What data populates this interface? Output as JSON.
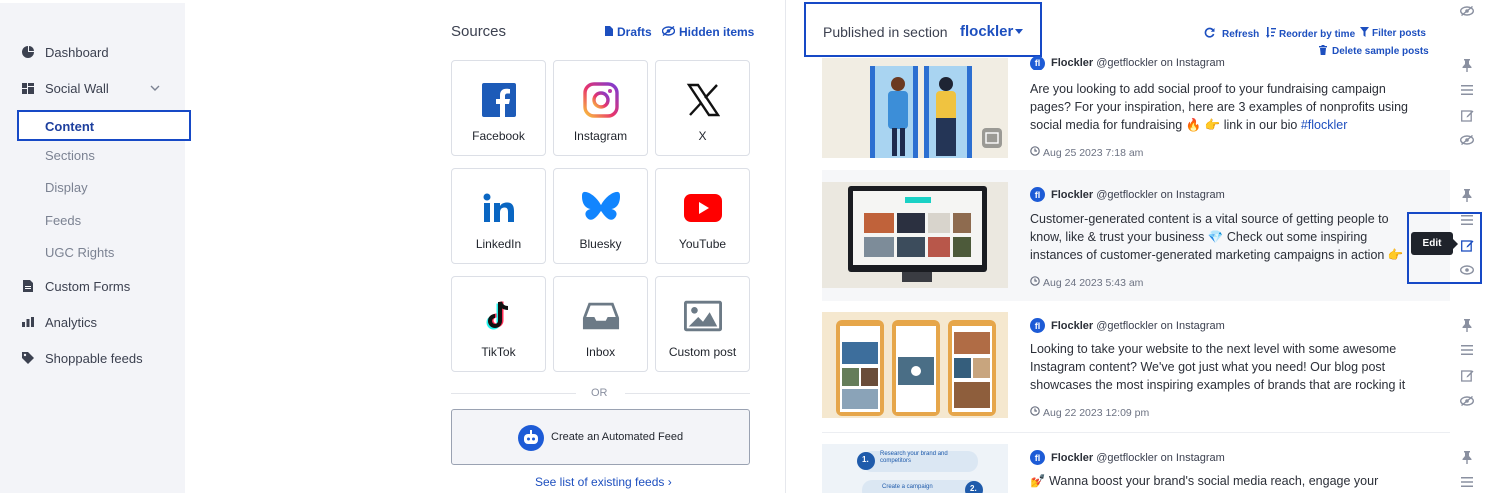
{
  "sidebar": {
    "items": [
      {
        "label": "Dashboard",
        "icon": "pie-chart-icon"
      },
      {
        "label": "Social Wall",
        "icon": "layout-icon"
      },
      {
        "label": "Custom Forms",
        "icon": "form-icon"
      },
      {
        "label": "Analytics",
        "icon": "bar-chart-icon"
      },
      {
        "label": "Shoppable feeds",
        "icon": "tag-icon"
      }
    ],
    "sub_items": [
      "Content",
      "Sections",
      "Display",
      "Feeds",
      "UGC Rights"
    ],
    "selected": "Content"
  },
  "sources": {
    "title": "Sources",
    "drafts_label": "Drafts",
    "hidden_label": "Hidden items",
    "tiles": [
      {
        "label": "Facebook",
        "icon": "facebook-icon"
      },
      {
        "label": "Instagram",
        "icon": "instagram-icon"
      },
      {
        "label": "X",
        "icon": "x-icon"
      },
      {
        "label": "LinkedIn",
        "icon": "linkedin-icon"
      },
      {
        "label": "Bluesky",
        "icon": "bluesky-icon"
      },
      {
        "label": "YouTube",
        "icon": "youtube-icon"
      },
      {
        "label": "TikTok",
        "icon": "tiktok-icon"
      },
      {
        "label": "Inbox",
        "icon": "inbox-icon"
      },
      {
        "label": "Custom post",
        "icon": "image-icon"
      }
    ],
    "or_label": "OR",
    "automated_feed_label": "Create an Automated Feed",
    "see_list_label": "See list of existing feeds ›"
  },
  "published": {
    "label": "Published in section",
    "section": "flockler",
    "actions": {
      "refresh": "Refresh",
      "reorder": "Reorder by time",
      "filter": "Filter posts",
      "delete_samples": "Delete sample posts"
    }
  },
  "posts": [
    {
      "author": "Flockler",
      "handle": "@getflockler on Instagram",
      "lines": [
        "Are you looking to add social proof to your fundraising campaign",
        "pages? For your inspiration, here are 3 examples of nonprofits using",
        "social media for fundraising 🔥 👉 link in our bio "
      ],
      "hashtag": "#flockler",
      "date": "Aug 25 2023 7:18 am"
    },
    {
      "author": "Flockler",
      "handle": "@getflockler on Instagram",
      "lines": [
        "Customer-generated content is a vital source of getting people to",
        "know, like & trust your business 💎 Check out some inspiring",
        "instances of customer-generated marketing campaigns in action 👉"
      ],
      "hashtag": "",
      "date": "Aug 24 2023 5:43 am"
    },
    {
      "author": "Flockler",
      "handle": "@getflockler on Instagram",
      "lines": [
        "Looking to take your website to the next level with some awesome",
        "Instagram content? We've got just what you need! Our blog post",
        "showcases the most inspiring examples of brands that are rocking it"
      ],
      "hashtag": "",
      "date": "Aug 22 2023 12:09 pm"
    },
    {
      "author": "Flockler",
      "handle": "@getflockler on Instagram",
      "lines": [
        "💅 Wanna boost your brand's social media reach, engage your"
      ],
      "hashtag": "",
      "date": ""
    }
  ],
  "thumb4_text": {
    "step1": "1.",
    "step1_text": "Research your brand and competitors",
    "step2": "2.",
    "step2_text": "Create a campaign"
  },
  "tooltip": "Edit",
  "colors": {
    "accent": "#1d4fbf",
    "highlight_border": "#1649c6",
    "sidebar_bg": "#f3f4f8"
  }
}
